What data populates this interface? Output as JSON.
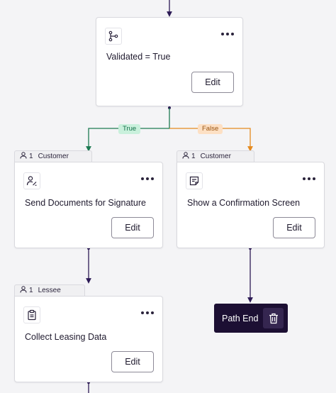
{
  "condition_node": {
    "title": "Validated = True",
    "icon": "branch-icon",
    "edit_label": "Edit"
  },
  "branches": {
    "true_label": "True",
    "false_label": "False",
    "true_color": "#1d7a52",
    "false_color": "#e58a1f"
  },
  "steps": [
    {
      "assignee_count": "1",
      "assignee_role": "Customer",
      "title": "Send Documents for Signature",
      "icon": "user-sign-icon",
      "edit_label": "Edit"
    },
    {
      "assignee_count": "1",
      "assignee_role": "Customer",
      "title": "Show a Confirmation Screen",
      "icon": "note-icon",
      "edit_label": "Edit"
    },
    {
      "assignee_count": "1",
      "assignee_role": "Lessee",
      "title": "Collect Leasing Data",
      "icon": "clipboard-icon",
      "edit_label": "Edit"
    }
  ],
  "path_end": {
    "label": "Path End",
    "icon": "trash-icon"
  },
  "colors": {
    "connector": "#2c1a55",
    "path_end_bg": "#1c0f33"
  }
}
